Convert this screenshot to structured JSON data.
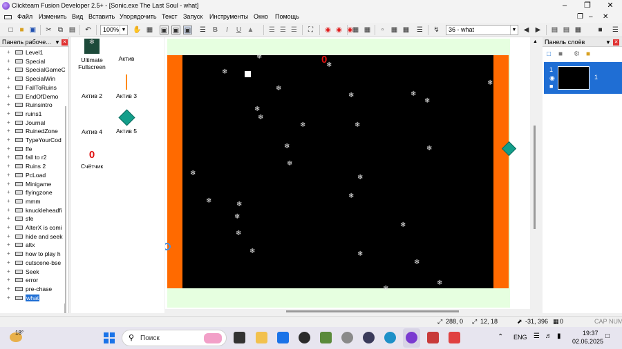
{
  "window": {
    "title": "Clickteam Fusion Developer 2.5+ - [Sonic.exe The Last Soul - what]"
  },
  "menu": [
    "Файл",
    "Изменить",
    "Вид",
    "Вставить",
    "Упорядочить",
    "Текст",
    "Запуск",
    "Инструменты",
    "Окно",
    "Помощь"
  ],
  "toolbar": {
    "zoom": "100%",
    "frame_selector": "36 - what",
    "font_bold": "B",
    "font_italic": "I",
    "font_underline": "U"
  },
  "workspace_panel": {
    "title": "Панель рабоче...",
    "items": [
      "Level1",
      "Special",
      "SpecialGameC",
      "SpecialWin",
      "FallToRuins",
      "EndOfDemo",
      "Ruinsintro",
      "ruins1",
      "Journal",
      "RuinedZone",
      "TypeYourCod",
      "ffe",
      "fall to r2",
      "Ruins 2",
      "PcLoad",
      "Minigame",
      "flyingzone",
      "mmm",
      "knuckleheadfi",
      "sfe",
      "AlterX is comi",
      "hide and seek",
      "altx",
      "how to play h",
      "cutscene-bse",
      "Seek",
      "error",
      "pre-chase",
      "what"
    ],
    "selected": "what"
  },
  "objects": {
    "items": [
      {
        "label": "Ultimate Fullscreen"
      },
      {
        "label": "Актив"
      },
      {
        "label": "Актив 2"
      },
      {
        "label": "Актив 3"
      },
      {
        "label": "Актив 4"
      },
      {
        "label": "Актив 5"
      },
      {
        "label": "Счётчик",
        "value": "0"
      }
    ]
  },
  "canvas": {
    "counter_value": "0",
    "colors": {
      "frame_bg": "#e6ffe0",
      "play_area": "#000000",
      "walls": "#ff6a00",
      "counter": "#e01010"
    }
  },
  "layers_panel": {
    "title": "Панель слоёв",
    "layer_index": "1",
    "layer_number": "1"
  },
  "status": {
    "pos": "288, 0",
    "size": "12, 18",
    "mouse": "-31, 396",
    "count": "0",
    "caps": "CAP",
    "num": "NUM"
  },
  "taskbar": {
    "weather": "18°",
    "search": "Поиск",
    "lang": "ENG",
    "time": "19:37",
    "date": "02.06.2025"
  }
}
